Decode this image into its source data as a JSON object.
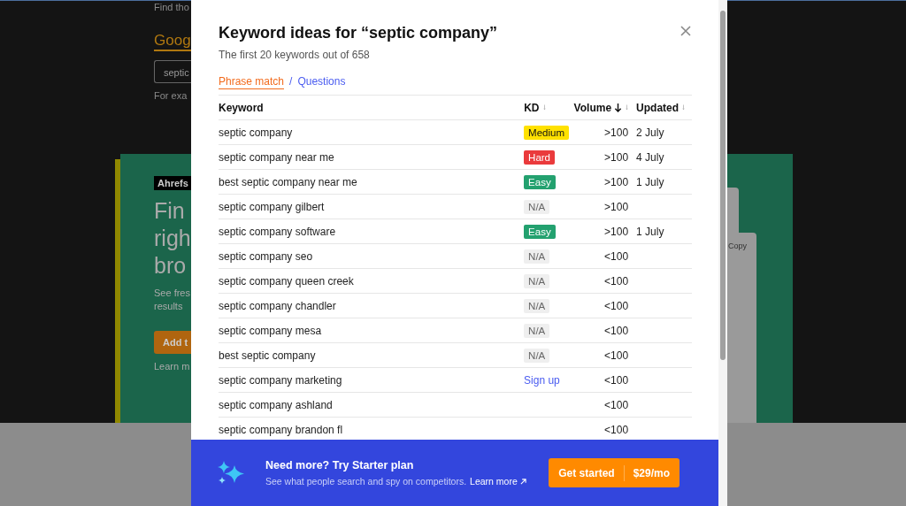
{
  "background": {
    "intro": "Find tho",
    "heading": "Goog",
    "search_value": "septic",
    "example": "For exa",
    "promo": {
      "tag": "Ahrefs",
      "headline": [
        "Fin",
        "righ",
        "bro"
      ],
      "text": [
        "See fres",
        "results"
      ],
      "button": "Add t",
      "link": "Learn m"
    },
    "side_panel": {
      "label": "Copy"
    }
  },
  "dialog": {
    "title": "Keyword ideas for “septic company”",
    "subtitle": "The first 20 keywords out of 658",
    "tabs": [
      {
        "label": "Phrase match",
        "selected": true
      },
      {
        "label": "Questions",
        "selected": false
      }
    ],
    "separator": "/",
    "columns": [
      {
        "label": "Keyword",
        "sortable": false,
        "sorted": false
      },
      {
        "label": "KD",
        "sortable": true,
        "sorted": false
      },
      {
        "label": "Volume",
        "sortable": true,
        "sorted": true
      },
      {
        "label": "Updated",
        "sortable": true,
        "sorted": false
      }
    ],
    "rows": [
      {
        "keyword": "septic company",
        "kd": {
          "kind": "medium",
          "label": "Medium"
        },
        "volume": ">100",
        "updated": "2 July"
      },
      {
        "keyword": "septic company near me",
        "kd": {
          "kind": "hard",
          "label": "Hard"
        },
        "volume": ">100",
        "updated": "4 July"
      },
      {
        "keyword": "best septic company near me",
        "kd": {
          "kind": "easy",
          "label": "Easy"
        },
        "volume": ">100",
        "updated": "1 July"
      },
      {
        "keyword": "septic company gilbert",
        "kd": {
          "kind": "na",
          "label": "N/A"
        },
        "volume": ">100"
      },
      {
        "keyword": "septic company software",
        "kd": {
          "kind": "easy",
          "label": "Easy"
        },
        "volume": ">100",
        "updated": "1 July"
      },
      {
        "keyword": "septic company seo",
        "kd": {
          "kind": "na",
          "label": "N/A"
        },
        "volume": "<100"
      },
      {
        "keyword": "septic company queen creek",
        "kd": {
          "kind": "na",
          "label": "N/A"
        },
        "volume": "<100"
      },
      {
        "keyword": "septic company chandler",
        "kd": {
          "kind": "na",
          "label": "N/A"
        },
        "volume": "<100"
      },
      {
        "keyword": "septic company mesa",
        "kd": {
          "kind": "na",
          "label": "N/A"
        },
        "volume": "<100"
      },
      {
        "keyword": "best septic company",
        "kd": {
          "kind": "na",
          "label": "N/A"
        },
        "volume": "<100"
      },
      {
        "keyword": "septic company marketing",
        "kd": {
          "kind": "signup",
          "label": "Sign up"
        },
        "volume": "<100"
      },
      {
        "keyword": "septic company ashland",
        "volume": "<100"
      },
      {
        "keyword": "septic company brandon fl",
        "volume": "<100"
      }
    ],
    "banner": {
      "title": "Need more? Try Starter plan",
      "text": "See what people search and spy on competitors.",
      "link": "Learn more",
      "button": {
        "label": "Get started",
        "price": "$29/mo"
      }
    }
  }
}
